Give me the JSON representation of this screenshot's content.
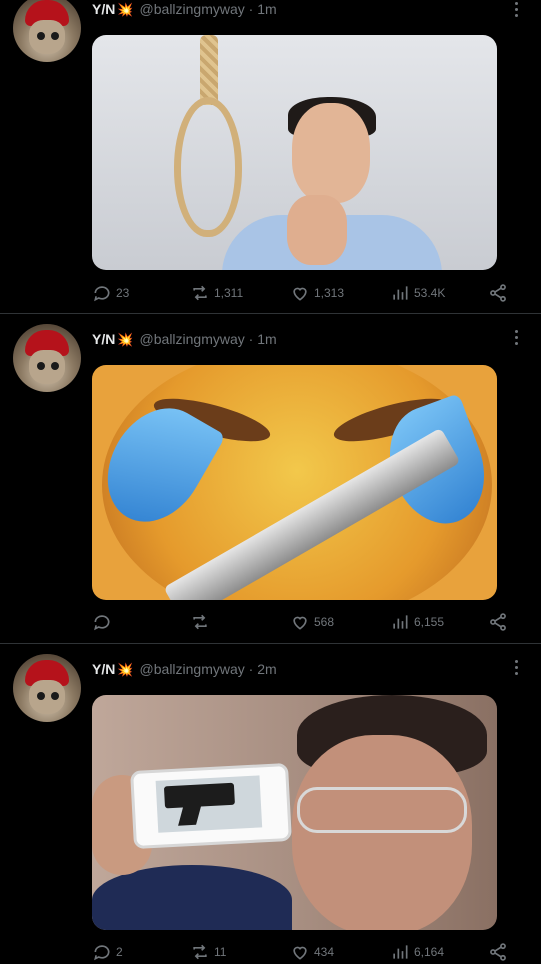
{
  "tweets": [
    {
      "name": "Y/N",
      "emoji": "💥",
      "handle": "@ballzingmyway · 1m",
      "media_desc": "",
      "replies": "23",
      "retweets": "1,311",
      "likes": "1,313",
      "views": "53.4K"
    },
    {
      "name": "Y/N",
      "emoji": "💥",
      "handle": "@ballzingmyway · 1m",
      "replies": "",
      "retweets": "",
      "likes": "568",
      "views": "6,155"
    },
    {
      "name": "Y/N",
      "emoji": "💥",
      "handle": "@ballzingmyway · 2m",
      "replies": "2",
      "retweets": "11",
      "likes": "434",
      "views": "6,164"
    }
  ],
  "colors": {
    "background": "#000000",
    "text": "#e7e9ea",
    "muted": "#71767b",
    "divider": "#2f3336"
  },
  "icons": {
    "reply": "reply-icon",
    "retweet": "retweet-icon",
    "like": "heart-icon",
    "views": "views-icon",
    "share": "share-icon",
    "more": "more-icon"
  }
}
